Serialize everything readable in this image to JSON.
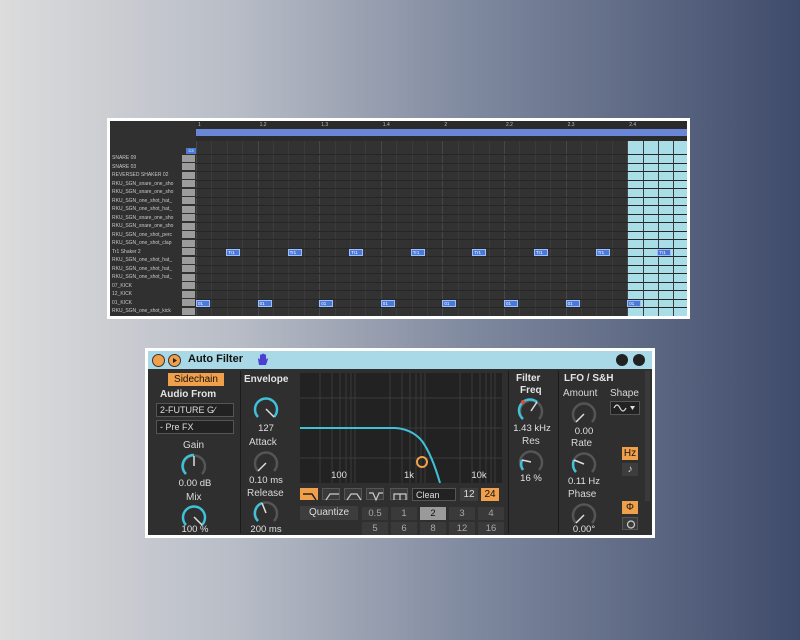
{
  "piano_roll": {
    "loop_marker": "C3",
    "bar_numbers": [
      "1",
      "1.2",
      "1.3",
      "1.4",
      "2",
      "2.2",
      "2.3",
      "2.4"
    ],
    "key_labels": [
      "SNARE 09",
      "SNARE 03",
      "REVERSED SHAKER 02",
      "RKU_SGN_snare_one_sho",
      "RKU_SGN_snare_one_sho",
      "RKU_SGN_one_shot_hat_",
      "RKU_SGN_one_shot_hat_",
      "RKU_SGN_snare_one_sho",
      "RKU_SGN_snare_one_sho",
      "RKU_SGN_one_shot_perc",
      "RKU_SGN_one_shot_clap",
      "Tr1 Shaker 2",
      "RKU_SGN_one_shot_hat_",
      "RKU_SGN_one_shot_hat_",
      "RKU_SGN_one_shot_hat_",
      "07_KICK",
      "12_KICK",
      "01_KICK",
      "RKU_SGN_one_shot_kick"
    ],
    "shaker_note_label": "Tr1",
    "kick_note_label": "01"
  },
  "device": {
    "title": "Auto Filter",
    "sidechain": {
      "button": "Sidechain",
      "audio_from_label": "Audio From",
      "source": "2-FUTURE G∕",
      "tap": "- Pre FX"
    },
    "gain": {
      "label": "Gain",
      "value": "0.00 dB"
    },
    "mix": {
      "label": "Mix",
      "value": "100 %"
    },
    "envelope": {
      "label": "Envelope",
      "value": "127"
    },
    "attack": {
      "label": "Attack",
      "value": "0.10 ms"
    },
    "release": {
      "label": "Release",
      "value": "200 ms"
    },
    "graph_ticks": [
      "100",
      "1k",
      "10k"
    ],
    "circuit": "Clean",
    "slope_12": "12",
    "slope_24": "24",
    "quantize": {
      "label": "Quantize",
      "row1": [
        "0.5",
        "1",
        "2",
        "3",
        "4"
      ],
      "row2": [
        "5",
        "6",
        "8",
        "12",
        "16"
      ],
      "selected": "2"
    },
    "filter": {
      "label_1": "Filter",
      "label_2": "Freq",
      "value": "1.43 kHz",
      "res_label": "Res",
      "res_value": "16 %"
    },
    "lfo": {
      "title": "LFO / S&H",
      "amount_label": "Amount",
      "amount_value": "0.00",
      "shape_label": "Shape",
      "rate_label": "Rate",
      "rate_value": "0.11 Hz",
      "hz_button": "Hz",
      "note_button": "♪",
      "phase_label": "Phase",
      "phase_value": "0.00°",
      "phase_button": "Φ"
    },
    "accent_color": "#f0a04b",
    "knob_arc_color": "#3fc1d8"
  }
}
